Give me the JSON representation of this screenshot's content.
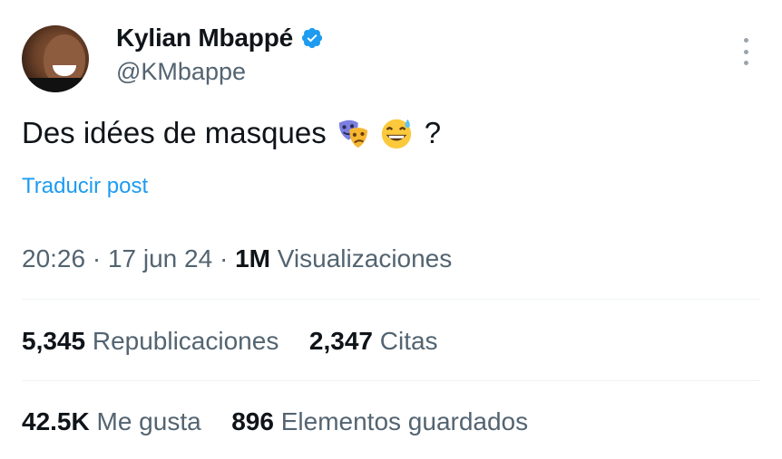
{
  "author": {
    "display_name": "Kylian Mbappé",
    "handle": "@KMbappe",
    "verified_color": "#1d9bf0"
  },
  "post": {
    "text": "Des idées de masques",
    "emojis": [
      "performing-arts-emoji",
      "grinning-sweat-emoji"
    ],
    "text_suffix": "?",
    "translate_label": "Traducir post"
  },
  "meta": {
    "time": "20:26",
    "sep1": "·",
    "date": "17 jun 24",
    "sep2": "·",
    "views_count": "1M",
    "views_label": "Visualizaciones"
  },
  "stats": {
    "reposts_count": "5,345",
    "reposts_label": "Republicaciones",
    "quotes_count": "2,347",
    "quotes_label": "Citas",
    "likes_count": "42.5K",
    "likes_label": "Me gusta",
    "bookmarks_count": "896",
    "bookmarks_label": "Elementos guardados"
  },
  "colors": {
    "text": "#0f1419",
    "secondary": "#536471",
    "link": "#1d9bf0",
    "divider": "#eff3f4"
  }
}
